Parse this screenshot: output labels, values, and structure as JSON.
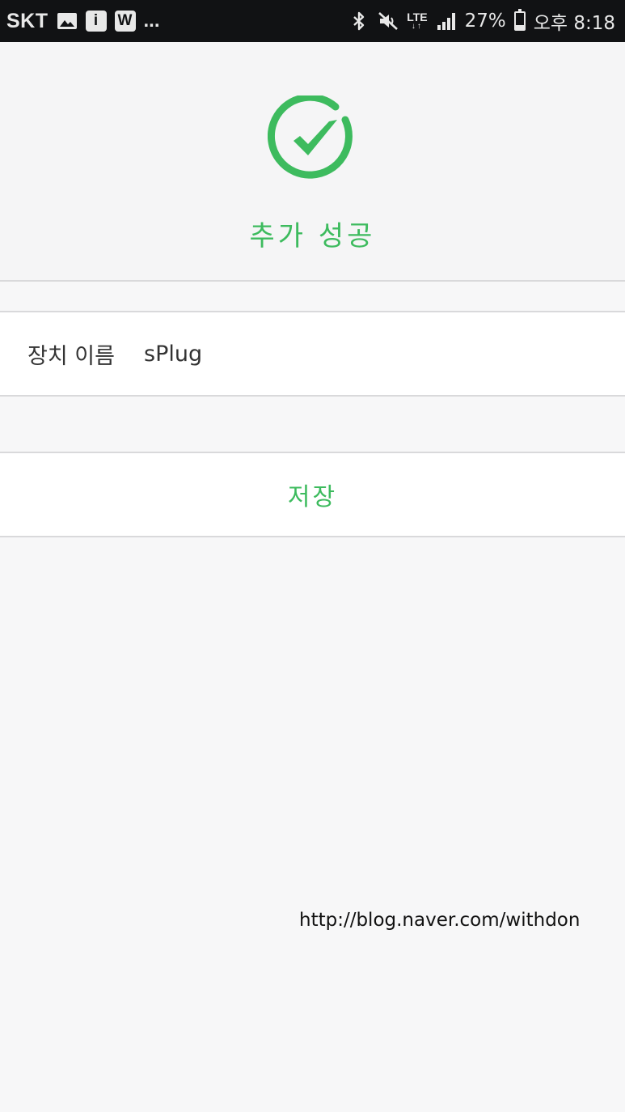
{
  "status_bar": {
    "carrier": "SKT",
    "notif_icons": [
      "gallery-icon",
      "info-icon",
      "w-app-icon"
    ],
    "info_glyph": "i",
    "w_glyph": "W",
    "more_dots": "...",
    "status_icons": [
      "bluetooth-icon",
      "mute-icon",
      "lte-icon",
      "signal-icon",
      "battery-icon"
    ],
    "lte_label": "LTE",
    "battery_percent": "27%",
    "battery_level": 0.27,
    "time": "오후 8:18"
  },
  "success": {
    "icon": "check-circle-icon",
    "title": "추가 성공"
  },
  "device": {
    "name_label": "장치 이름",
    "name_value": "sPlug"
  },
  "save": {
    "label": "저장"
  },
  "watermark": "http://blog.naver.com/withdon",
  "colors": {
    "accent": "#3dbb5e",
    "status_bar": "#111214",
    "background": "#f7f7f8",
    "divider": "#d9d9db"
  }
}
